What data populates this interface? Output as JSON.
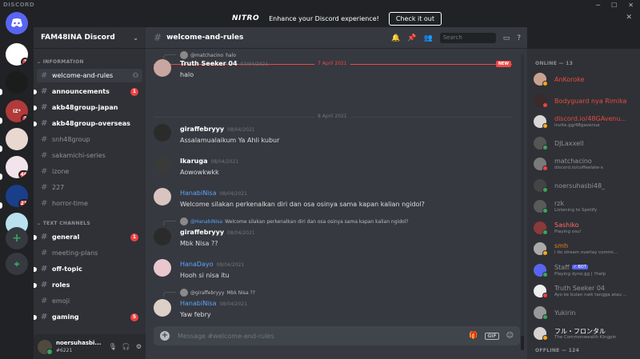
{
  "window": {
    "brand": "DISCORD",
    "minimize": "─",
    "maximize": "☐",
    "close": "✕"
  },
  "nitro": {
    "logo": "NITRO",
    "text": "Enhance your Discord experience!",
    "button": "Check it out",
    "close": "✕"
  },
  "servers": {
    "items": [
      {
        "abbr": "",
        "badge": "7",
        "color": "#ffffff"
      },
      {
        "abbr": "",
        "badge": "",
        "color": "#1c1c1c"
      },
      {
        "abbr": "IZ*",
        "badge": "2",
        "color": "#b23a3a"
      },
      {
        "abbr": "",
        "badge": "",
        "color": "#e8d8d0"
      },
      {
        "abbr": "",
        "badge": "46",
        "color": "#f2e4ea"
      },
      {
        "abbr": "",
        "badge": "23",
        "color": "#1a3f8a"
      },
      {
        "abbr": "",
        "badge": "",
        "color": "#b9e0ef"
      }
    ],
    "add_label": "+",
    "explore_label": "⌖"
  },
  "guild": {
    "name": "FAM48INA Discord",
    "chevron": "⌄"
  },
  "channels": {
    "category_info": "INFORMATION",
    "category_text": "TEXT CHANNELS",
    "info": [
      {
        "name": "welcome-and-rules",
        "state": "active",
        "badge": ""
      },
      {
        "name": "announcements",
        "state": "unread",
        "badge": "1"
      },
      {
        "name": "akb48group-japan",
        "state": "unread",
        "badge": ""
      },
      {
        "name": "akb48group-overseas",
        "state": "unread",
        "badge": ""
      },
      {
        "name": "snh48group",
        "state": "muted",
        "badge": ""
      },
      {
        "name": "sakamichi-series",
        "state": "muted",
        "badge": ""
      },
      {
        "name": "izone",
        "state": "muted",
        "badge": ""
      },
      {
        "name": "227",
        "state": "muted",
        "badge": ""
      },
      {
        "name": "horror-time",
        "state": "muted",
        "badge": ""
      }
    ],
    "text": [
      {
        "name": "general",
        "state": "unread",
        "badge": "1"
      },
      {
        "name": "meeting-plans",
        "state": "muted",
        "badge": ""
      },
      {
        "name": "off-topic",
        "state": "unread",
        "badge": ""
      },
      {
        "name": "roles",
        "state": "unread",
        "badge": ""
      },
      {
        "name": "emoji",
        "state": "muted",
        "badge": ""
      },
      {
        "name": "gaming",
        "state": "unread",
        "badge": "5"
      }
    ]
  },
  "user": {
    "name": "noersuhasbi...",
    "tag": "#6221",
    "mic": "🎙",
    "headset": "🎧",
    "settings": "⚙"
  },
  "chat": {
    "channel": "welcome-and-rules",
    "search_placeholder": "Search",
    "composer_placeholder": "Message #welcome-and-rules",
    "gif": "GIF",
    "date1": "7 April 2021",
    "new_tag": "NEW",
    "date2": "8 April 2021",
    "messages": [
      {
        "reply_name": "@matchacino",
        "reply_text": "halo",
        "author": "Truth Seeker 04",
        "ts": "07/04/2021",
        "body": "halo",
        "color": "white"
      },
      {
        "author": "giraffebryyy",
        "ts": "08/04/2021",
        "body": "Assalamualaikum Ya Ahli kubur",
        "color": "white"
      },
      {
        "author": "Ikaruga",
        "ts": "08/04/2021",
        "body": "Aowowkwkk",
        "color": "white"
      },
      {
        "author": "HanabiNisa",
        "ts": "08/04/2021",
        "body": "Welcome silakan perkenalkan diri dan osa osinya sama kapan kalian ngidol?",
        "color": "blue"
      },
      {
        "reply_name": "@HanabiNisa",
        "reply_text": "Welcome silakan perkenalkan diri dan osa osinya sama kapan kalian ngidol?",
        "author": "giraffebryyy",
        "ts": "08/04/2021",
        "body": "Mbk Nisa ??",
        "color": "white"
      },
      {
        "author": "HanaDayo",
        "ts": "08/04/2021",
        "body": "Hooh si nisa itu",
        "color": "blue"
      },
      {
        "reply_name": "@giraffebryyy",
        "reply_text": "Mbk Nisa ??",
        "author": "HanabiNisa",
        "ts": "08/04/2021",
        "body": "Yaw febry",
        "color": "blue"
      }
    ]
  },
  "members": {
    "online_header": "ONLINE — 13",
    "offline_header": "OFFLINE — 124",
    "list": [
      {
        "name": "AnKoroke",
        "activity": "",
        "status": "idle",
        "color": "#e74c3c",
        "bot": ""
      },
      {
        "name": "Bodyguard nya Rimika",
        "activity": "",
        "status": "dnd",
        "color": "#e74c3c",
        "bot": ""
      },
      {
        "name": "discord.io/48GAvenu...",
        "activity": "invite.gg/48gavenue",
        "status": "idle",
        "color": "#e74c3c",
        "bot": ""
      },
      {
        "name": "DJLaxxell",
        "activity": "",
        "status": "online",
        "color": "#8e9297",
        "bot": ""
      },
      {
        "name": "matchacino",
        "activity": "discord.io/coffeelate-x",
        "status": "dnd",
        "color": "#8e9297",
        "bot": ""
      },
      {
        "name": "noersuhasbi48_",
        "activity": "",
        "status": "online",
        "color": "#8e9297",
        "bot": ""
      },
      {
        "name": "rzk",
        "activity": "Listening to Spotify",
        "status": "online",
        "color": "#8e9297",
        "bot": ""
      },
      {
        "name": "Sashiko",
        "activity": "Playing osu!",
        "status": "online",
        "color": "#ff6b6b",
        "bot": ""
      },
      {
        "name": "smh",
        "activity": "i do stream overlay commi...",
        "status": "idle",
        "color": "#e67e22",
        "bot": ""
      },
      {
        "name": "Staff",
        "activity": "Playing dyno.gg | ?help",
        "status": "online",
        "color": "#8e9297",
        "bot": "✓ BOT"
      },
      {
        "name": "Truth Seeker 04",
        "activity": "Ayo ke bulan naik tangga atau ...",
        "status": "dnd",
        "color": "#8e9297",
        "bot": ""
      },
      {
        "name": "Yukirin",
        "activity": "",
        "status": "online",
        "color": "#8e9297",
        "bot": ""
      },
      {
        "name": "フル・フロンタル",
        "activity": "The Commonwealth Kingpin",
        "status": "idle",
        "color": "#ffffff",
        "bot": ""
      }
    ]
  }
}
